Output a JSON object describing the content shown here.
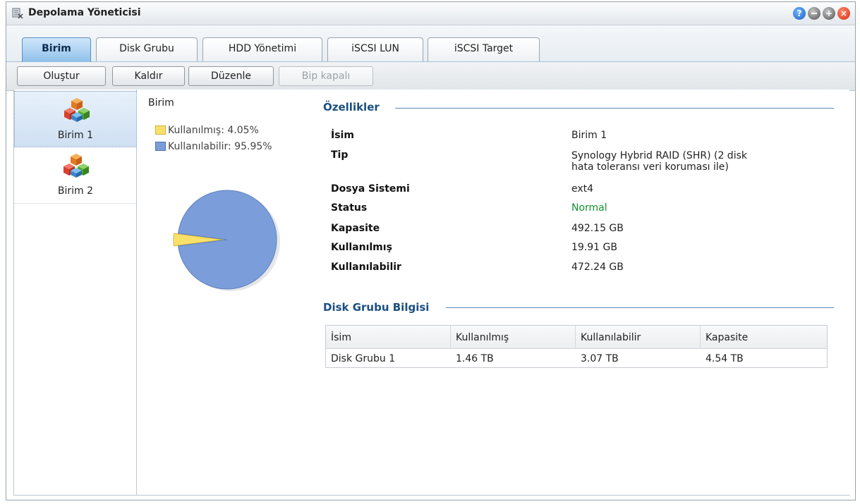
{
  "window": {
    "title": "Depolama Yöneticisi",
    "title_icon": "storage-manager-icon"
  },
  "window_buttons": [
    "help",
    "minimize",
    "maximize",
    "close"
  ],
  "tabs": [
    {
      "label": "Birim",
      "active": true
    },
    {
      "label": "Disk Grubu",
      "active": false
    },
    {
      "label": "HDD Yönetimi",
      "active": false
    },
    {
      "label": "iSCSI LUN",
      "active": false
    },
    {
      "label": "iSCSI Target",
      "active": false
    }
  ],
  "toolbar": [
    {
      "label": "Oluştur",
      "enabled": true
    },
    {
      "label": "Kaldır",
      "enabled": true
    },
    {
      "label": "Düzenle",
      "enabled": true
    },
    {
      "label": "Bip kapalı",
      "enabled": false
    }
  ],
  "sidebar": {
    "items": [
      {
        "label": "Birim 1",
        "selected": true,
        "icon": "volume-cubes-icon"
      },
      {
        "label": "Birim 2",
        "selected": false,
        "icon": "volume-cubes-icon"
      }
    ]
  },
  "usage": {
    "title": "Birim",
    "legend": [
      {
        "label": "Kullanılmış: 4.05%",
        "color": "#f9e06b"
      },
      {
        "label": "Kullanılabilir: 95.95%",
        "color": "#7b9edb"
      }
    ]
  },
  "chart_data": {
    "type": "pie",
    "title": "Birim",
    "slices": [
      {
        "label": "Kullanılmış",
        "value": 4.05,
        "color": "#f9e06b"
      },
      {
        "label": "Kullanılabilir",
        "value": 95.95,
        "color": "#7b9edb"
      }
    ]
  },
  "properties": {
    "section_title": "Özellikler",
    "rows": [
      {
        "label": "İsim",
        "value": "Birim 1"
      },
      {
        "label": "Tip",
        "value_lines": [
          "Synology Hybrid RAID (SHR) (2 disk",
          "hata toleransı veri koruması ile)"
        ]
      },
      {
        "label": "Dosya Sistemi",
        "value": "ext4"
      },
      {
        "label": "Status",
        "value": "Normal",
        "color": "#12932b"
      },
      {
        "label": "Kapasite",
        "value": "492.15 GB"
      },
      {
        "label": "Kullanılmış",
        "value": "19.91 GB"
      },
      {
        "label": "Kullanılabilir",
        "value": "472.24 GB"
      }
    ]
  },
  "disk_group": {
    "section_title": "Disk Grubu Bilgisi",
    "columns": [
      "İsim",
      "Kullanılmış",
      "Kullanılabilir",
      "Kapasite"
    ],
    "rows": [
      [
        "Disk Grubu 1",
        "1.46 TB",
        "3.07 TB",
        "4.54 TB"
      ]
    ]
  }
}
